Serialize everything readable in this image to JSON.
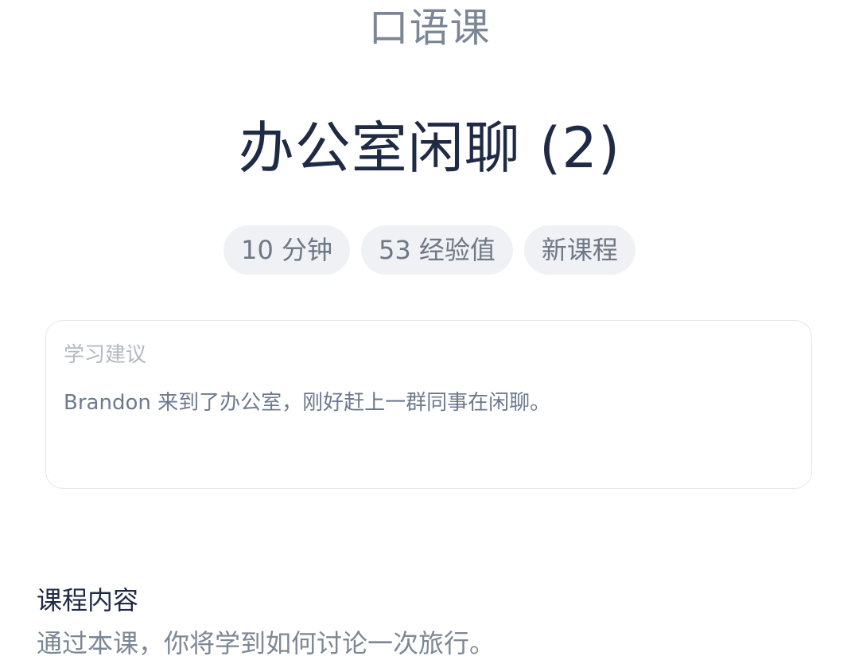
{
  "header": {
    "category": "口语课",
    "lesson_title": "办公室闲聊 (2)"
  },
  "tags": [
    {
      "label": "10 分钟"
    },
    {
      "label": "53 经验值"
    },
    {
      "label": "新课程"
    }
  ],
  "study_tip": {
    "heading": "学习建议",
    "body": "Brandon 来到了办公室，刚好赶上一群同事在闲聊。"
  },
  "course_content": {
    "heading": "课程内容",
    "body": "通过本课，你将学到如何讨论一次旅行。"
  }
}
